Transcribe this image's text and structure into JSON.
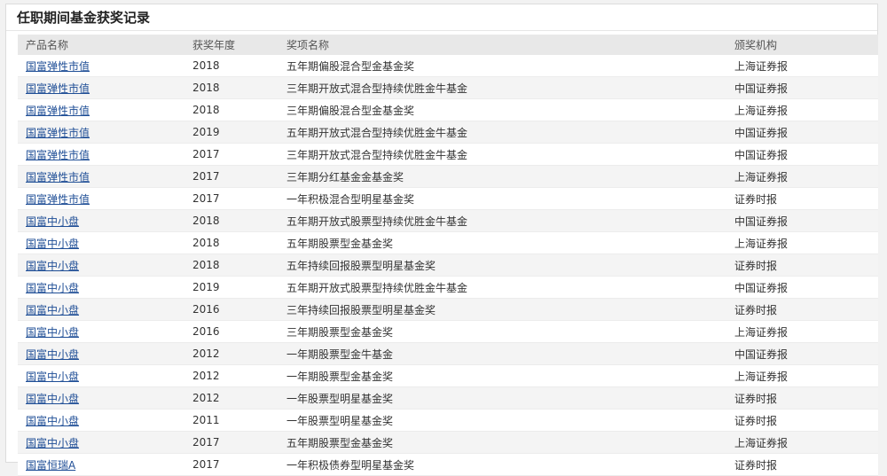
{
  "panel": {
    "title": "任职期间基金获奖记录"
  },
  "table": {
    "headers": [
      "产品名称",
      "获奖年度",
      "奖项名称",
      "颁奖机构"
    ],
    "rows": [
      [
        "国富弹性市值",
        "2018",
        "五年期偏股混合型金基金奖",
        "上海证券报"
      ],
      [
        "国富弹性市值",
        "2018",
        "三年期开放式混合型持续优胜金牛基金",
        "中国证券报"
      ],
      [
        "国富弹性市值",
        "2018",
        "三年期偏股混合型金基金奖",
        "上海证券报"
      ],
      [
        "国富弹性市值",
        "2019",
        "五年期开放式混合型持续优胜金牛基金",
        "中国证券报"
      ],
      [
        "国富弹性市值",
        "2017",
        "三年期开放式混合型持续优胜金牛基金",
        "中国证券报"
      ],
      [
        "国富弹性市值",
        "2017",
        "三年期分红基金金基金奖",
        "上海证券报"
      ],
      [
        "国富弹性市值",
        "2017",
        "一年积极混合型明星基金奖",
        "证券时报"
      ],
      [
        "国富中小盘",
        "2018",
        "五年期开放式股票型持续优胜金牛基金",
        "中国证券报"
      ],
      [
        "国富中小盘",
        "2018",
        "五年期股票型金基金奖",
        "上海证券报"
      ],
      [
        "国富中小盘",
        "2018",
        "五年持续回报股票型明星基金奖",
        "证券时报"
      ],
      [
        "国富中小盘",
        "2019",
        "五年期开放式股票型持续优胜金牛基金",
        "中国证券报"
      ],
      [
        "国富中小盘",
        "2016",
        "三年持续回报股票型明星基金奖",
        "证券时报"
      ],
      [
        "国富中小盘",
        "2016",
        "三年期股票型金基金奖",
        "上海证券报"
      ],
      [
        "国富中小盘",
        "2012",
        "一年期股票型金牛基金",
        "中国证券报"
      ],
      [
        "国富中小盘",
        "2012",
        "一年期股票型金基金奖",
        "上海证券报"
      ],
      [
        "国富中小盘",
        "2012",
        "一年股票型明星基金奖",
        "证券时报"
      ],
      [
        "国富中小盘",
        "2011",
        "一年股票型明星基金奖",
        "证券时报"
      ],
      [
        "国富中小盘",
        "2017",
        "五年期股票型金基金奖",
        "上海证券报"
      ],
      [
        "国富恒瑞A",
        "2017",
        "一年积极债券型明星基金奖",
        "证券时报"
      ]
    ]
  },
  "colors": {
    "link": "#1f4e96",
    "header_bg": "#e8e8e8",
    "row_alt_bg": "#f4f4f4"
  }
}
